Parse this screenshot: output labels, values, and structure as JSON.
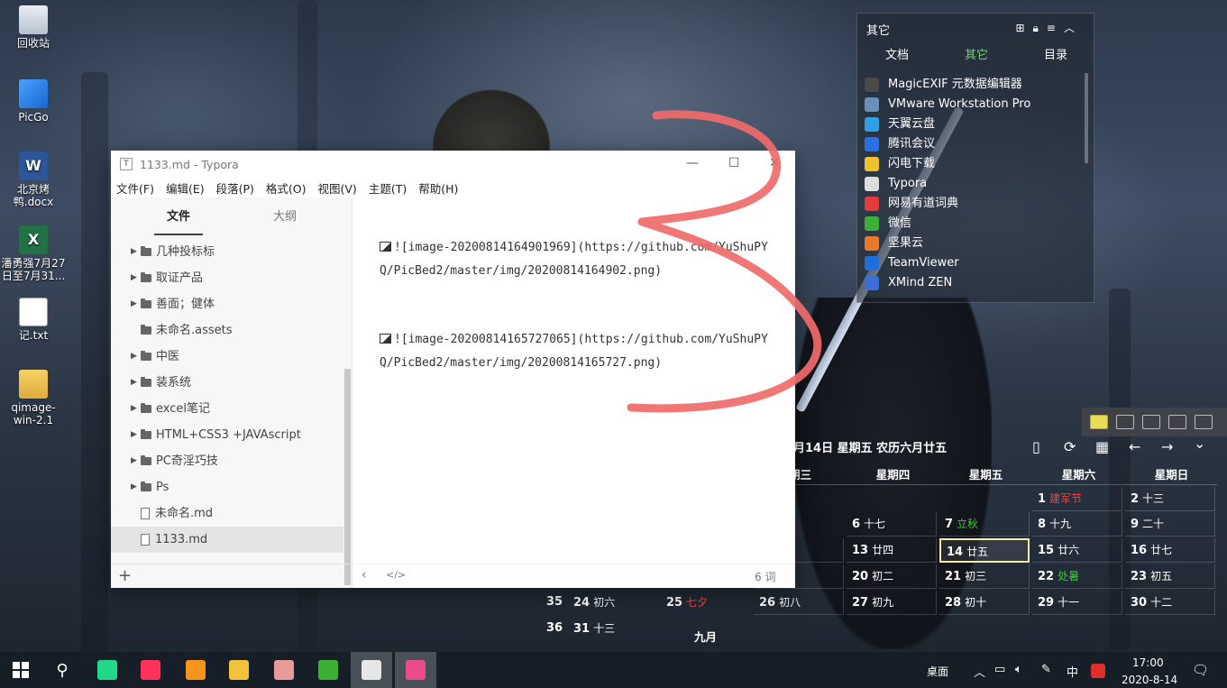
{
  "desktop": {
    "icons": [
      {
        "label": "回收站"
      },
      {
        "label": "PicGo"
      },
      {
        "label": "北京烤鸭.docx"
      },
      {
        "label": "潘勇强7月27日至7月31..."
      },
      {
        "label": "记.txt"
      },
      {
        "label": "qimage-win-2.1"
      }
    ]
  },
  "typora": {
    "title": "1133.md - Typora",
    "app_icon": "T",
    "menu": [
      "文件(F)",
      "编辑(E)",
      "段落(P)",
      "格式(O)",
      "视图(V)",
      "主题(T)",
      "帮助(H)"
    ],
    "sidebar_tabs": [
      "文件",
      "大纲"
    ],
    "tree": [
      {
        "name": "几种投标标",
        "type": "folder",
        "expandable": true
      },
      {
        "name": "取证产品",
        "type": "folder",
        "expandable": true
      },
      {
        "name": "善面；健体",
        "type": "folder",
        "expandable": true
      },
      {
        "name": "未命名.assets",
        "type": "folder",
        "expandable": false
      },
      {
        "name": "中医",
        "type": "folder",
        "expandable": true
      },
      {
        "name": "装系统",
        "type": "folder",
        "expandable": true
      },
      {
        "name": "excel笔记",
        "type": "folder",
        "expandable": true
      },
      {
        "name": "HTML+CSS3 +JAVAscript",
        "type": "folder",
        "expandable": true
      },
      {
        "name": "PC奇淫巧技",
        "type": "folder",
        "expandable": true
      },
      {
        "name": "Ps",
        "type": "folder",
        "expandable": true
      },
      {
        "name": "未命名.md",
        "type": "file",
        "expandable": false
      },
      {
        "name": "1133.md",
        "type": "file",
        "expandable": false,
        "active": true
      }
    ],
    "editor_lines": [
      "![image-20200814164901969](https://github.com/YuShuPYQ/PicBed2/master/img/20200814164902.png)",
      "![image-20200814165727065](https://github.com/YuShuPYQ/PicBed2/master/img/20200814165727.png)"
    ],
    "status_left_icons": [
      "chevron-left-icon",
      "code-icon"
    ],
    "status_left": "‹",
    "status_code": "</>",
    "word_count": "6 词",
    "add_button": "+"
  },
  "launcher": {
    "title": "其它",
    "tabs": [
      "文档",
      "其它",
      "目录"
    ],
    "active_tab": "其它",
    "items": [
      {
        "label": "MagicEXIF 元数据编辑器",
        "color": "#4a4a4a"
      },
      {
        "label": "VMware Workstation Pro",
        "color": "#6b8fb8"
      },
      {
        "label": "天翼云盘",
        "color": "#2fa0e6"
      },
      {
        "label": "腾讯会议",
        "color": "#2c6fe0"
      },
      {
        "label": "闪电下载",
        "color": "#f2c12e"
      },
      {
        "label": "Typora",
        "color": "#dddddd"
      },
      {
        "label": "网易有道词典",
        "color": "#e23b3b"
      },
      {
        "label": "微信",
        "color": "#3cb034"
      },
      {
        "label": "坚果云",
        "color": "#e8792c"
      },
      {
        "label": "TeamViewer",
        "color": "#1e6fd9"
      },
      {
        "label": "XMind ZEN",
        "color": "#3b6fd6"
      }
    ]
  },
  "calendar": {
    "header": "月14日 星期五 农历六月廿五",
    "weekdays": [
      "期三",
      "星期四",
      "星期五",
      "星期六",
      "星期日"
    ],
    "weeks": [
      {
        "num": "",
        "cells": [
          {
            "col": 3,
            "day": "1",
            "lunar": "建军节",
            "color": "#ff4040"
          },
          {
            "col": 4,
            "day": "2",
            "lunar": "十三"
          }
        ]
      },
      {
        "num": "",
        "cells": [
          {
            "col": 1,
            "day": "6",
            "lunar": "十七"
          },
          {
            "col": 2,
            "day": "7",
            "lunar": "立秋",
            "color": "#3ec73e"
          },
          {
            "col": 3,
            "day": "8",
            "lunar": "十九"
          },
          {
            "col": 4,
            "day": "9",
            "lunar": "二十"
          }
        ]
      },
      {
        "num": "",
        "cells": [
          {
            "col": 0,
            "day": "",
            "lunar": "三"
          },
          {
            "col": 1,
            "day": "13",
            "lunar": "廿四"
          },
          {
            "col": 2,
            "day": "14",
            "lunar": "廿五",
            "today": true
          },
          {
            "col": 3,
            "day": "15",
            "lunar": "廿六"
          },
          {
            "col": 4,
            "day": "16",
            "lunar": "廿七"
          }
        ]
      },
      {
        "num": "",
        "cells": [
          {
            "col": 0,
            "day": "",
            "lunar": "历七月"
          },
          {
            "col": 1,
            "day": "20",
            "lunar": "初二"
          },
          {
            "col": 2,
            "day": "21",
            "lunar": "初三"
          },
          {
            "col": 3,
            "day": "22",
            "lunar": "处暑",
            "color": "#3ec73e"
          },
          {
            "col": 4,
            "day": "23",
            "lunar": "初五"
          }
        ]
      },
      {
        "num": "35",
        "cells": [
          {
            "col": -2,
            "day": "24",
            "lunar": "初六"
          },
          {
            "col": -1,
            "day": "25",
            "lunar": "七夕",
            "color": "#ff4040"
          },
          {
            "col": 0,
            "day": "26",
            "lunar": "初八"
          },
          {
            "col": 1,
            "day": "27",
            "lunar": "初九"
          },
          {
            "col": 2,
            "day": "28",
            "lunar": "初十"
          },
          {
            "col": 3,
            "day": "29",
            "lunar": "十一"
          },
          {
            "col": 4,
            "day": "30",
            "lunar": "十二"
          }
        ]
      },
      {
        "num": "36",
        "cells": [
          {
            "col": -2,
            "day": "31",
            "lunar": "十三"
          }
        ]
      }
    ],
    "next_month": "九月",
    "toolbar_icons": [
      "sticky-note-icon",
      "notepad-icon",
      "contacts-icon",
      "search-icon",
      "camera-icon"
    ],
    "nav_icons": [
      "phone-icon",
      "sync-icon",
      "calendar-icon",
      "arrow-left-icon",
      "arrow-right-icon",
      "chevron-down-icon"
    ],
    "nav_glyphs": [
      "▯",
      "⟳",
      "▦",
      "←",
      "→",
      "⌄"
    ]
  },
  "taskbar": {
    "apps": [
      {
        "name": "pycharm-icon",
        "color": "#21d789"
      },
      {
        "name": "intellij-icon",
        "color": "#fe315d"
      },
      {
        "name": "search-tool-icon",
        "color": "#f7941d"
      },
      {
        "name": "file-explorer-icon",
        "color": "#f3c13a"
      },
      {
        "name": "notepad-app-icon",
        "color": "#e89a9a"
      },
      {
        "name": "wechat-icon",
        "color": "#3cb034"
      },
      {
        "name": "typora-icon",
        "color": "#e6e6e6",
        "active": true
      },
      {
        "name": "chrome-like-icon",
        "color": "#ea4c89",
        "active": true
      }
    ],
    "desktop_label": "桌面",
    "tray": {
      "ime": "中",
      "time": "17:00",
      "date": "2020-8-14"
    }
  }
}
